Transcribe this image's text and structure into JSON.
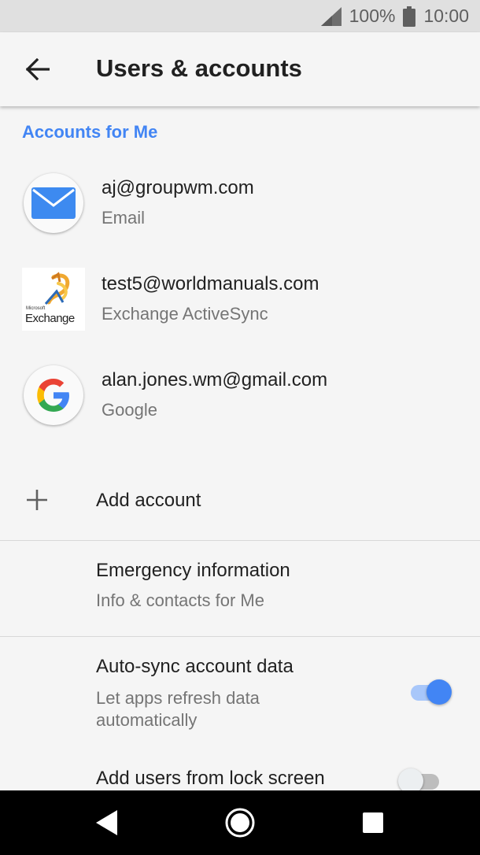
{
  "status_bar": {
    "battery_percent": "100%",
    "time": "10:00",
    "icons": [
      "signal-icon",
      "battery-icon"
    ]
  },
  "app_bar": {
    "title": "Users & accounts",
    "back_icon": "arrow-back-icon"
  },
  "section": {
    "header": "Accounts for Me"
  },
  "accounts": [
    {
      "title": "aj@groupwm.com",
      "subtitle": "Email",
      "icon": "email-icon"
    },
    {
      "title": "test5@worldmanuals.com",
      "subtitle": "Exchange ActiveSync",
      "icon": "exchange-icon",
      "icon_text_small": "Microsoft",
      "icon_text_large": "Exchange"
    },
    {
      "title": "alan.jones.wm@gmail.com",
      "subtitle": "Google",
      "icon": "google-icon"
    }
  ],
  "add_account": {
    "label": "Add account",
    "icon": "plus-icon"
  },
  "preferences": [
    {
      "title": "Emergency information",
      "subtitle": "Info & contacts for Me"
    },
    {
      "title": "Auto-sync account data",
      "subtitle": "Let apps refresh data automatically",
      "toggle": true
    },
    {
      "title": "Add users from lock screen",
      "toggle": false
    }
  ],
  "colors": {
    "accent": "#4285f4",
    "status_bar_bg": "#e0e0e0",
    "background": "#f5f5f5",
    "nav_bar_bg": "#000000"
  },
  "nav_bar": {
    "icons": [
      "back-icon",
      "home-icon",
      "recents-icon"
    ]
  }
}
